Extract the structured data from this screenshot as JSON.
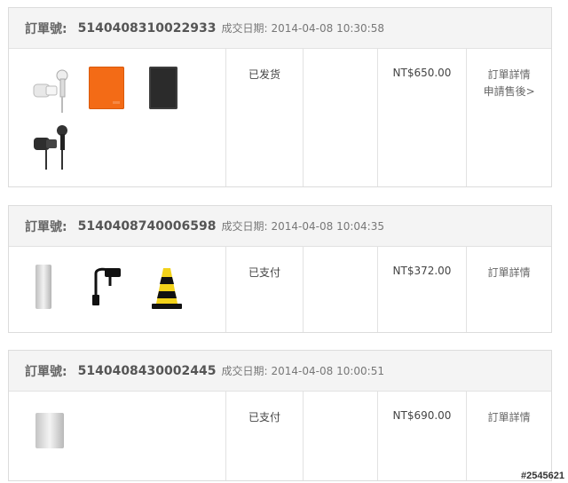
{
  "orders": [
    {
      "label": "訂單號:",
      "number": "5140408310022933",
      "date_label": "成交日期:",
      "date": "2014-04-08 10:30:58",
      "status": "已发货",
      "price": "NT$650.00",
      "actions": [
        "訂單詳情",
        "申請售後>"
      ],
      "products": [
        "white-earphones",
        "orange-battery-cover",
        "black-tablet-case",
        "black-earphones"
      ]
    },
    {
      "label": "訂單號:",
      "number": "5140408740006598",
      "date_label": "成交日期:",
      "date": "2014-04-08 10:04:35",
      "status": "已支付",
      "price": "NT$372.00",
      "actions": [
        "訂單詳情"
      ],
      "products": [
        "silver-power-bank",
        "otg-cable",
        "traffic-cone"
      ]
    },
    {
      "label": "訂單號:",
      "number": "5140408430002445",
      "date_label": "成交日期:",
      "date": "2014-04-08 10:00:51",
      "status": "已支付",
      "price": "NT$690.00",
      "actions": [
        "訂單詳情"
      ],
      "products": [
        "silver-power-bank"
      ]
    }
  ],
  "watermark": "#2545621"
}
